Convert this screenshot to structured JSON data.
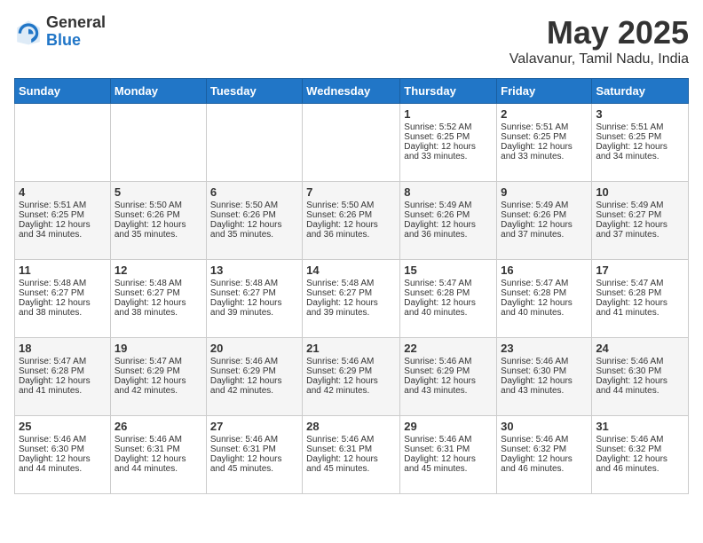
{
  "header": {
    "logo_general": "General",
    "logo_blue": "Blue",
    "month_year": "May 2025",
    "location": "Valavanur, Tamil Nadu, India"
  },
  "weekdays": [
    "Sunday",
    "Monday",
    "Tuesday",
    "Wednesday",
    "Thursday",
    "Friday",
    "Saturday"
  ],
  "weeks": [
    [
      {
        "day": "",
        "info": ""
      },
      {
        "day": "",
        "info": ""
      },
      {
        "day": "",
        "info": ""
      },
      {
        "day": "",
        "info": ""
      },
      {
        "day": "1",
        "info": "Sunrise: 5:52 AM\nSunset: 6:25 PM\nDaylight: 12 hours\nand 33 minutes."
      },
      {
        "day": "2",
        "info": "Sunrise: 5:51 AM\nSunset: 6:25 PM\nDaylight: 12 hours\nand 33 minutes."
      },
      {
        "day": "3",
        "info": "Sunrise: 5:51 AM\nSunset: 6:25 PM\nDaylight: 12 hours\nand 34 minutes."
      }
    ],
    [
      {
        "day": "4",
        "info": "Sunrise: 5:51 AM\nSunset: 6:25 PM\nDaylight: 12 hours\nand 34 minutes."
      },
      {
        "day": "5",
        "info": "Sunrise: 5:50 AM\nSunset: 6:26 PM\nDaylight: 12 hours\nand 35 minutes."
      },
      {
        "day": "6",
        "info": "Sunrise: 5:50 AM\nSunset: 6:26 PM\nDaylight: 12 hours\nand 35 minutes."
      },
      {
        "day": "7",
        "info": "Sunrise: 5:50 AM\nSunset: 6:26 PM\nDaylight: 12 hours\nand 36 minutes."
      },
      {
        "day": "8",
        "info": "Sunrise: 5:49 AM\nSunset: 6:26 PM\nDaylight: 12 hours\nand 36 minutes."
      },
      {
        "day": "9",
        "info": "Sunrise: 5:49 AM\nSunset: 6:26 PM\nDaylight: 12 hours\nand 37 minutes."
      },
      {
        "day": "10",
        "info": "Sunrise: 5:49 AM\nSunset: 6:27 PM\nDaylight: 12 hours\nand 37 minutes."
      }
    ],
    [
      {
        "day": "11",
        "info": "Sunrise: 5:48 AM\nSunset: 6:27 PM\nDaylight: 12 hours\nand 38 minutes."
      },
      {
        "day": "12",
        "info": "Sunrise: 5:48 AM\nSunset: 6:27 PM\nDaylight: 12 hours\nand 38 minutes."
      },
      {
        "day": "13",
        "info": "Sunrise: 5:48 AM\nSunset: 6:27 PM\nDaylight: 12 hours\nand 39 minutes."
      },
      {
        "day": "14",
        "info": "Sunrise: 5:48 AM\nSunset: 6:27 PM\nDaylight: 12 hours\nand 39 minutes."
      },
      {
        "day": "15",
        "info": "Sunrise: 5:47 AM\nSunset: 6:28 PM\nDaylight: 12 hours\nand 40 minutes."
      },
      {
        "day": "16",
        "info": "Sunrise: 5:47 AM\nSunset: 6:28 PM\nDaylight: 12 hours\nand 40 minutes."
      },
      {
        "day": "17",
        "info": "Sunrise: 5:47 AM\nSunset: 6:28 PM\nDaylight: 12 hours\nand 41 minutes."
      }
    ],
    [
      {
        "day": "18",
        "info": "Sunrise: 5:47 AM\nSunset: 6:28 PM\nDaylight: 12 hours\nand 41 minutes."
      },
      {
        "day": "19",
        "info": "Sunrise: 5:47 AM\nSunset: 6:29 PM\nDaylight: 12 hours\nand 42 minutes."
      },
      {
        "day": "20",
        "info": "Sunrise: 5:46 AM\nSunset: 6:29 PM\nDaylight: 12 hours\nand 42 minutes."
      },
      {
        "day": "21",
        "info": "Sunrise: 5:46 AM\nSunset: 6:29 PM\nDaylight: 12 hours\nand 42 minutes."
      },
      {
        "day": "22",
        "info": "Sunrise: 5:46 AM\nSunset: 6:29 PM\nDaylight: 12 hours\nand 43 minutes."
      },
      {
        "day": "23",
        "info": "Sunrise: 5:46 AM\nSunset: 6:30 PM\nDaylight: 12 hours\nand 43 minutes."
      },
      {
        "day": "24",
        "info": "Sunrise: 5:46 AM\nSunset: 6:30 PM\nDaylight: 12 hours\nand 44 minutes."
      }
    ],
    [
      {
        "day": "25",
        "info": "Sunrise: 5:46 AM\nSunset: 6:30 PM\nDaylight: 12 hours\nand 44 minutes."
      },
      {
        "day": "26",
        "info": "Sunrise: 5:46 AM\nSunset: 6:31 PM\nDaylight: 12 hours\nand 44 minutes."
      },
      {
        "day": "27",
        "info": "Sunrise: 5:46 AM\nSunset: 6:31 PM\nDaylight: 12 hours\nand 45 minutes."
      },
      {
        "day": "28",
        "info": "Sunrise: 5:46 AM\nSunset: 6:31 PM\nDaylight: 12 hours\nand 45 minutes."
      },
      {
        "day": "29",
        "info": "Sunrise: 5:46 AM\nSunset: 6:31 PM\nDaylight: 12 hours\nand 45 minutes."
      },
      {
        "day": "30",
        "info": "Sunrise: 5:46 AM\nSunset: 6:32 PM\nDaylight: 12 hours\nand 46 minutes."
      },
      {
        "day": "31",
        "info": "Sunrise: 5:46 AM\nSunset: 6:32 PM\nDaylight: 12 hours\nand 46 minutes."
      }
    ]
  ]
}
